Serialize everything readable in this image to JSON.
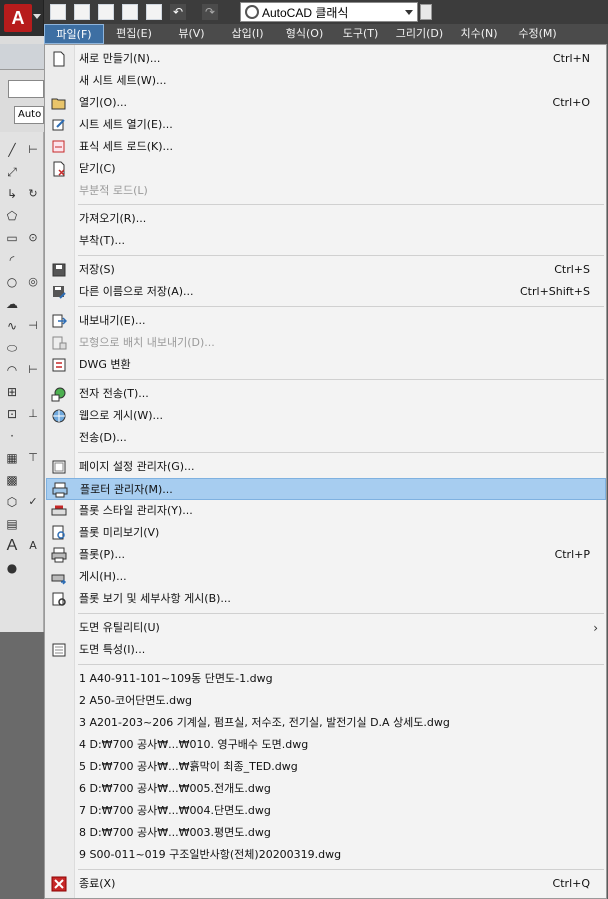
{
  "workspace": {
    "name": "AutoCAD 클래식"
  },
  "app": {
    "logo_letter": "A"
  },
  "menubar": {
    "items": [
      {
        "label": "파일(F)",
        "active": true
      },
      {
        "label": "편집(E)"
      },
      {
        "label": "뷰(V)"
      },
      {
        "label": "삽입(I)"
      },
      {
        "label": "형식(O)"
      },
      {
        "label": "도구(T)"
      },
      {
        "label": "그리기(D)"
      },
      {
        "label": "치수(N)"
      },
      {
        "label": "수정(M)"
      }
    ]
  },
  "background": {
    "tab_text": "Auto"
  },
  "file_menu": {
    "items": [
      {
        "label": "새로 만들기(N)...",
        "shortcut": "Ctrl+N",
        "icon": "new-icon"
      },
      {
        "label": "새 시트 세트(W)...",
        "shortcut": "",
        "icon": ""
      },
      {
        "label": "열기(O)...",
        "shortcut": "Ctrl+O",
        "icon": "open-folder-icon"
      },
      {
        "label": "시트 세트 열기(E)...",
        "shortcut": "",
        "icon": "sheet-set-icon"
      },
      {
        "label": "표식 세트 로드(K)...",
        "shortcut": "",
        "icon": "markup-icon"
      },
      {
        "label": "닫기(C)",
        "shortcut": "",
        "icon": "close-doc-icon"
      },
      {
        "label": "부분적 로드(L)",
        "shortcut": "",
        "icon": "",
        "disabled": true
      },
      {
        "label": "가져오기(R)...",
        "shortcut": "",
        "icon": ""
      },
      {
        "label": "부착(T)...",
        "shortcut": "",
        "icon": ""
      },
      {
        "label": "저장(S)",
        "shortcut": "Ctrl+S",
        "icon": "save-icon"
      },
      {
        "label": "다른 이름으로 저장(A)...",
        "shortcut": "Ctrl+Shift+S",
        "icon": "save-as-icon"
      },
      {
        "label": "내보내기(E)...",
        "shortcut": "",
        "icon": "export-icon"
      },
      {
        "label": "모형으로 배치 내보내기(D)...",
        "shortcut": "",
        "icon": "export-layout-icon",
        "disabled": true
      },
      {
        "label": "DWG 변환",
        "shortcut": "",
        "icon": "dwg-convert-icon"
      },
      {
        "label": "전자 전송(T)...",
        "shortcut": "",
        "icon": "etransmit-icon"
      },
      {
        "label": "웹으로 게시(W)...",
        "shortcut": "",
        "icon": "publish-web-icon"
      },
      {
        "label": "전송(D)...",
        "shortcut": "",
        "icon": ""
      },
      {
        "label": "페이지 설정 관리자(G)...",
        "shortcut": "",
        "icon": "page-setup-icon"
      },
      {
        "label": "플로터 관리자(M)...",
        "shortcut": "",
        "icon": "plotter-icon",
        "highlighted": true
      },
      {
        "label": "플롯 스타일 관리자(Y)...",
        "shortcut": "",
        "icon": "plot-style-icon"
      },
      {
        "label": "플롯 미리보기(V)",
        "shortcut": "",
        "icon": "plot-preview-icon"
      },
      {
        "label": "플롯(P)...",
        "shortcut": "Ctrl+P",
        "icon": "plot-icon"
      },
      {
        "label": "게시(H)...",
        "shortcut": "",
        "icon": "publish-icon"
      },
      {
        "label": "플롯 보기 및 세부사항 게시(B)...",
        "shortcut": "",
        "icon": "plot-details-icon"
      },
      {
        "label": "도면 유틸리티(U)",
        "shortcut": "",
        "icon": "",
        "submenu": true
      },
      {
        "label": "도면 특성(I)...",
        "shortcut": "",
        "icon": "drawing-props-icon"
      },
      {
        "label": "1 A40-911-101~109동 단면도-1.dwg",
        "shortcut": "",
        "icon": ""
      },
      {
        "label": "2 A50-코어단면도.dwg",
        "shortcut": "",
        "icon": ""
      },
      {
        "label": "3 A201-203~206 기계실, 펌프실, 저수조, 전기실, 발전기실 D.A 상세도.dwg",
        "shortcut": "",
        "icon": ""
      },
      {
        "label": "4 D:₩700 공사₩...₩010. 영구배수 도면.dwg",
        "shortcut": "",
        "icon": ""
      },
      {
        "label": "5 D:₩700 공사₩...₩흙막이 최종_TED.dwg",
        "shortcut": "",
        "icon": ""
      },
      {
        "label": "6 D:₩700 공사₩...₩005.전개도.dwg",
        "shortcut": "",
        "icon": ""
      },
      {
        "label": "7 D:₩700 공사₩...₩004.단면도.dwg",
        "shortcut": "",
        "icon": ""
      },
      {
        "label": "8 D:₩700 공사₩...₩003.평면도.dwg",
        "shortcut": "",
        "icon": ""
      },
      {
        "label": "9 S00-011~019 구조일반사항(전체)20200319.dwg",
        "shortcut": "",
        "icon": ""
      },
      {
        "label": "종료(X)",
        "shortcut": "Ctrl+Q",
        "icon": "exit-icon"
      }
    ],
    "submenu_glyph": "›"
  }
}
